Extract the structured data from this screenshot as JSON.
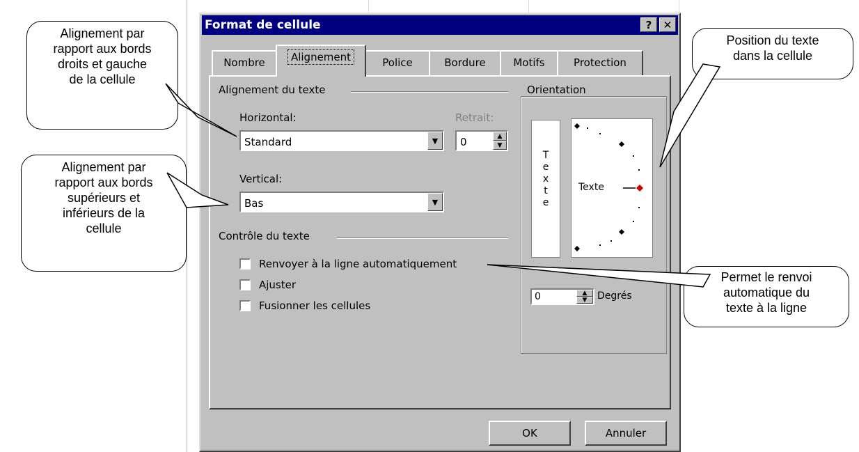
{
  "dialog": {
    "title": "Format de cellule",
    "help_btn": "?",
    "close_btn": "✕",
    "tabs": [
      "Nombre",
      "Alignement",
      "Police",
      "Bordure",
      "Motifs",
      "Protection"
    ],
    "active_tab": "Alignement"
  },
  "text_alignment": {
    "group_label": "Alignement du texte",
    "horizontal_label": "Horizontal:",
    "horizontal_value": "Standard",
    "indent_label": "Retrait:",
    "indent_value": "0",
    "vertical_label": "Vertical:",
    "vertical_value": "Bas"
  },
  "text_control": {
    "group_label": "Contrôle du texte",
    "checkboxes": [
      {
        "label": "Renvoyer à la ligne automatiquement",
        "checked": false
      },
      {
        "label": "Ajuster",
        "checked": false
      },
      {
        "label": "Fusionner les cellules",
        "checked": false
      }
    ]
  },
  "orientation": {
    "group_label": "Orientation",
    "vertical_text_letters": [
      "T",
      "e",
      "x",
      "t",
      "e"
    ],
    "dial_label": "Texte",
    "degrees_value": "0",
    "degrees_label": "Degrés"
  },
  "buttons": {
    "ok": "OK",
    "cancel": "Annuler"
  },
  "callouts": {
    "horizontal": [
      "Alignement par",
      "rapport aux bords",
      "droits et gauche",
      "de la cellule"
    ],
    "vertical": [
      "Alignement par",
      "rapport aux bords",
      "supérieurs et",
      "inférieurs de la",
      "cellule"
    ],
    "position": [
      "Position du texte",
      "dans la cellule"
    ],
    "wrap": [
      "Permet le renvoi",
      "automatique du",
      "texte à la ligne"
    ]
  },
  "colors": {
    "titlebar": "#000080",
    "dialog_face": "#c0c0c0",
    "dial_marker_active": "#cc0000"
  }
}
